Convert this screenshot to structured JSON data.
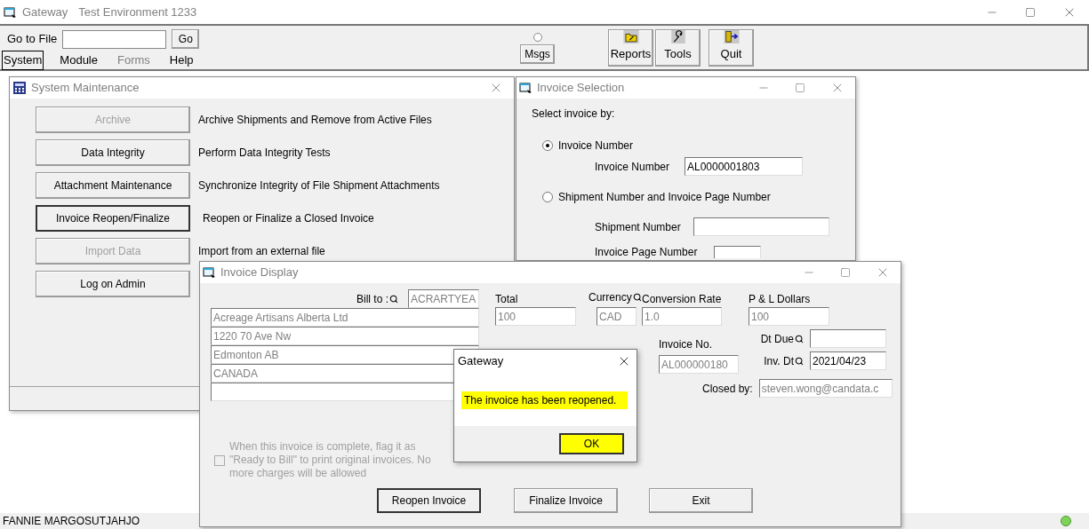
{
  "app": {
    "title": "Gateway",
    "environment": "Test Environment 1233"
  },
  "toolbar": {
    "goto_label": "Go to File",
    "go_button": "Go",
    "msgs_button": "Msgs",
    "menu": [
      {
        "label": "System",
        "selected": true,
        "disabled": false
      },
      {
        "label": "Module",
        "selected": false,
        "disabled": false
      },
      {
        "label": "Forms",
        "selected": false,
        "disabled": true
      },
      {
        "label": "Help",
        "selected": false,
        "disabled": false
      }
    ],
    "tools": [
      {
        "label": "Reports",
        "kind": "reports"
      },
      {
        "label": "Tools",
        "kind": "tools"
      },
      {
        "label": "Quit",
        "kind": "quit"
      }
    ]
  },
  "system_maintenance": {
    "title": "System Maintenance",
    "items": [
      {
        "button": "Archive",
        "description": "Archive Shipments and Remove from Active Files",
        "disabled": true,
        "default": false
      },
      {
        "button": "Data Integrity",
        "description": "Perform Data Integrity Tests",
        "disabled": false,
        "default": false
      },
      {
        "button": "Attachment Maintenance",
        "description": "Synchronize Integrity of File Shipment Attachments",
        "disabled": false,
        "default": false
      },
      {
        "button": "Invoice Reopen/Finalize",
        "description": "Reopen or Finalize a Closed Invoice",
        "disabled": false,
        "default": true
      },
      {
        "button": "Import Data",
        "description": "Import from an external file",
        "disabled": true,
        "default": false
      },
      {
        "button": "Log on Admin",
        "disabled": false,
        "default": false
      }
    ]
  },
  "invoice_selection": {
    "title": "Invoice Selection",
    "prompt": "Select invoice by:",
    "options": [
      {
        "label": "Invoice Number",
        "selected": true
      },
      {
        "label": "Shipment Number and Invoice Page Number",
        "selected": false
      }
    ],
    "invoice_number": {
      "label": "Invoice Number",
      "value": "AL0000001803"
    },
    "shipment_number": {
      "label": "Shipment Number"
    },
    "page_number": {
      "label": "Invoice Page Number"
    }
  },
  "invoice_display": {
    "title": "Invoice Display",
    "bill_to_label": "Bill to :",
    "bill_to_code": "ACRARTYEA",
    "address": [
      "Acreage Artisans Alberta Ltd",
      "1220 70 Ave Nw",
      "Edmonton AB",
      "CANADA"
    ],
    "total": {
      "label": "Total",
      "value": "100"
    },
    "currency": {
      "label": "Currency",
      "value": "CAD"
    },
    "conversion_rate": {
      "label": "Conversion Rate",
      "value": "1.0"
    },
    "pl_dollars": {
      "label": "P & L Dollars",
      "value": "100"
    },
    "invoice_no": {
      "label": "Invoice No.",
      "value": "AL000000180"
    },
    "dt_due": {
      "label": "Dt Due"
    },
    "inv_dt": {
      "label": "Inv. Dt",
      "value": "2021/04/23"
    },
    "closed_by": {
      "label": "Closed by:",
      "value": "steven.wong@candata.c"
    },
    "ready_to_bill": {
      "label": "When this invoice is complete, flag it as \"Ready to Bill\" to print original invoices. No more charges will be allowed",
      "checked": false,
      "disabled": true
    },
    "buttons": [
      {
        "label": "Reopen Invoice",
        "default": true
      },
      {
        "label": "Finalize Invoice",
        "default": false
      },
      {
        "label": "Exit",
        "default": false
      }
    ]
  },
  "dialog": {
    "title": "Gateway",
    "message": "The invoice has been reopened.",
    "highlighted": true,
    "ok": "OK"
  },
  "status_bar": {
    "user": "FANNIE MARGOSUTJAHJO"
  }
}
